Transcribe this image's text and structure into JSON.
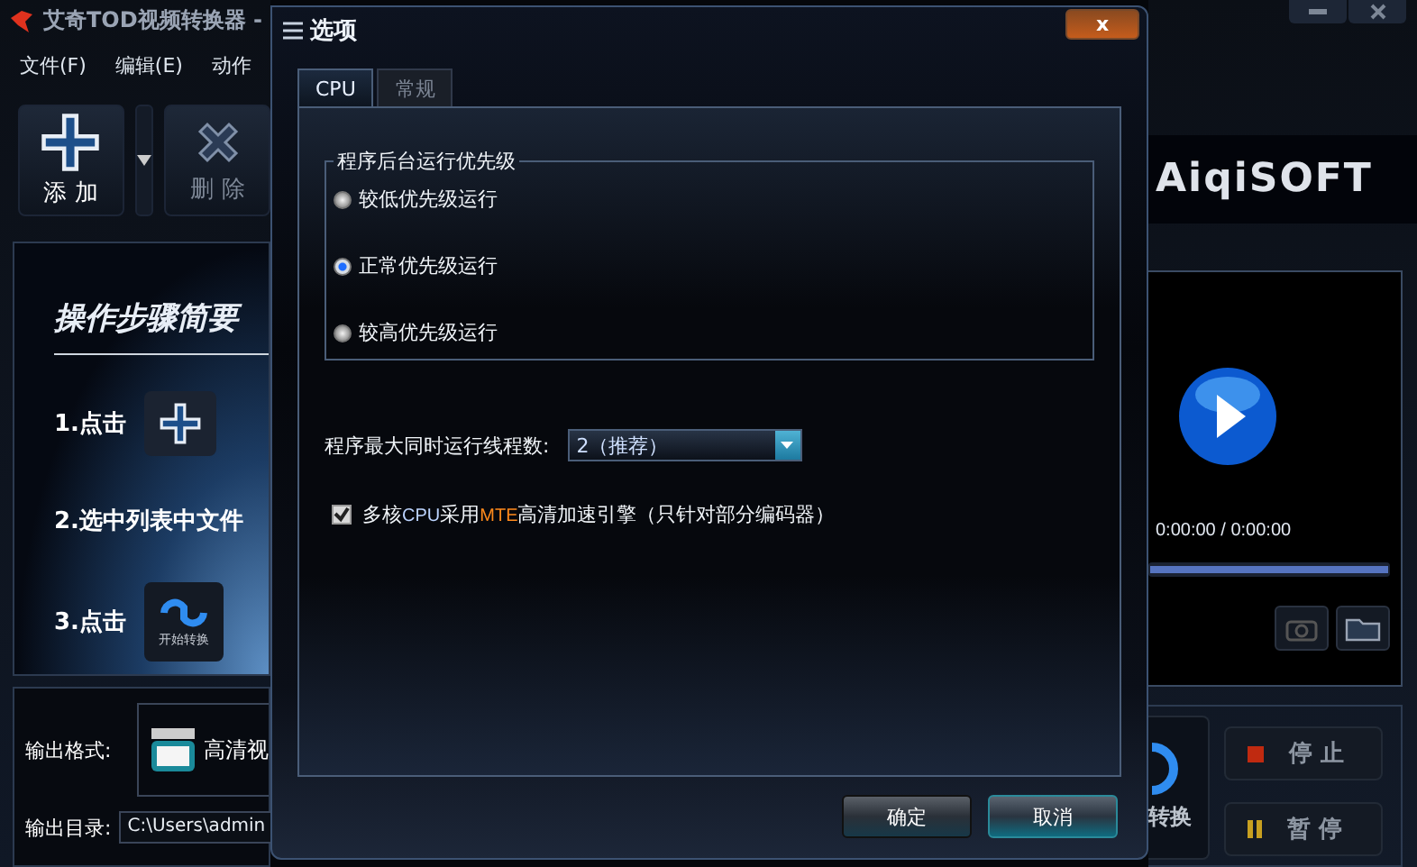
{
  "app": {
    "title": "艾奇TOD视频转换器 -",
    "menu": [
      "文件(F)",
      "编辑(E)",
      "动作"
    ],
    "toolbar": [
      {
        "kind": "add",
        "label": "添 加"
      },
      {
        "kind": "delete",
        "label": "删 除"
      }
    ],
    "steps": {
      "heading": "操作步骤简要",
      "items": [
        {
          "kind": "add",
          "text": "1.点击"
        },
        {
          "kind": "plain",
          "text": "2.选中列表中文件"
        },
        {
          "kind": "convert",
          "text": "3.点击",
          "icon_label": "开始转换"
        }
      ]
    },
    "output": {
      "format_label": "输出格式:",
      "format_value": "高清视",
      "dir_label": "输出目录:",
      "dir_value": "C:\\Users\\admin"
    },
    "logo": "AiqiSOFT",
    "player": {
      "time": "0:00:00 / 0:00:00",
      "level": 1
    },
    "actions": [
      {
        "kind": "convert",
        "label": "转换"
      },
      {
        "kind": "stop",
        "label": "停 止"
      },
      {
        "kind": "pause",
        "label": "暂 停"
      }
    ]
  },
  "dialog": {
    "title": "选项",
    "close": "x",
    "tabs": [
      {
        "label": "CPU",
        "selected": true
      },
      {
        "label": "常规",
        "selected": false
      }
    ],
    "priority": {
      "legend": "程序后台运行优先级",
      "options": [
        {
          "label": "较低优先级运行",
          "selected": false
        },
        {
          "label": "正常优先级运行",
          "selected": true
        },
        {
          "label": "较高优先级运行",
          "selected": false
        }
      ]
    },
    "threads": {
      "label": "程序最大同时运行线程数:",
      "value": "2（推荐）"
    },
    "mte": {
      "checked": true,
      "parts": [
        {
          "kind": "normal",
          "text": "多核"
        },
        {
          "kind": "latin",
          "text": "CPU"
        },
        {
          "kind": "normal",
          "text": "采用"
        },
        {
          "kind": "accent",
          "text": "MTE"
        },
        {
          "kind": "normal",
          "text": "高清加速引擎（只针对部分编码器）"
        }
      ]
    },
    "buttons": [
      {
        "label": "确定",
        "focused": false
      },
      {
        "label": "取消",
        "focused": true
      }
    ]
  }
}
